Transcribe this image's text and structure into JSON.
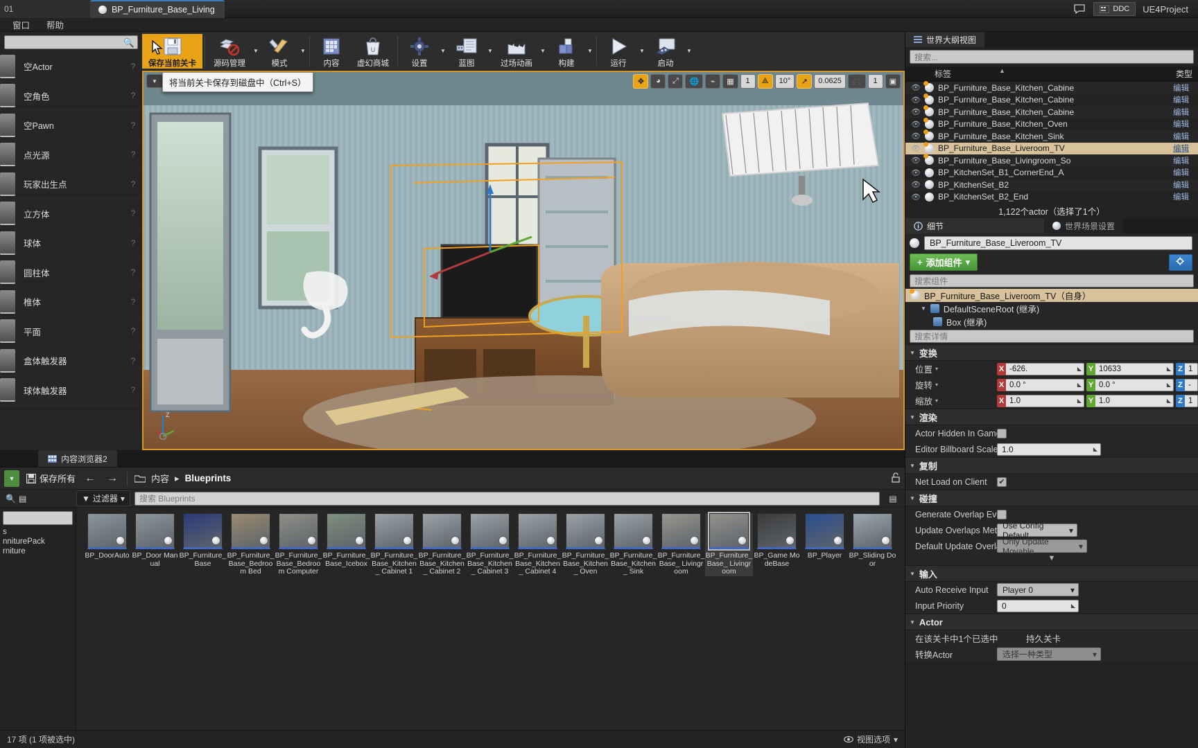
{
  "titlebar": {
    "left_tab": "01",
    "active_tab": "BP_Furniture_Base_Living",
    "ddc_label": "DDC",
    "project": "UE4Project"
  },
  "menubar": {
    "items": [
      "窗口",
      "帮助"
    ]
  },
  "toolbar": {
    "items": [
      {
        "label": "保存当前关卡",
        "icon": "save-icon",
        "highlight": true,
        "caret": false
      },
      {
        "label": "源码管理",
        "icon": "source-control-icon",
        "caret": true
      },
      {
        "label": "模式",
        "icon": "modes-icon",
        "caret": true
      },
      {
        "label": "内容",
        "icon": "content-icon",
        "caret": false
      },
      {
        "label": "虚幻商城",
        "icon": "marketplace-icon",
        "caret": false
      },
      {
        "label": "设置",
        "icon": "settings-icon",
        "caret": true
      },
      {
        "label": "蓝图",
        "icon": "blueprint-icon",
        "caret": true
      },
      {
        "label": "过场动画",
        "icon": "cinematics-icon",
        "caret": true
      },
      {
        "label": "构建",
        "icon": "build-icon",
        "caret": true
      },
      {
        "label": "运行",
        "icon": "play-icon",
        "caret": true
      },
      {
        "label": "启动",
        "icon": "launch-icon",
        "caret": true
      }
    ],
    "tooltip": "将当前关卡保存到磁盘中（Ctrl+S）"
  },
  "place_actors": {
    "search_placeholder": "",
    "items": [
      {
        "label": "空Actor",
        "icon": "empty-actor-icon"
      },
      {
        "label": "空角色",
        "icon": "character-icon"
      },
      {
        "label": "空Pawn",
        "icon": "pawn-icon"
      },
      {
        "label": "点光源",
        "icon": "point-light-icon"
      },
      {
        "label": "玩家出生点",
        "icon": "player-start-icon"
      },
      {
        "label": "立方体",
        "icon": "cube-icon"
      },
      {
        "label": "球体",
        "icon": "sphere-icon"
      },
      {
        "label": "圆柱体",
        "icon": "cylinder-icon"
      },
      {
        "label": "椎体",
        "icon": "cone-icon"
      },
      {
        "label": "平面",
        "icon": "plane-icon"
      },
      {
        "label": "盒体触发器",
        "icon": "box-trigger-icon"
      },
      {
        "label": "球体触发器",
        "icon": "sphere-trigger-icon"
      }
    ],
    "help_glyph": "?"
  },
  "viewport": {
    "tools": [
      {
        "name": "move-tool",
        "glyph": "✥",
        "active": true
      },
      {
        "name": "rotate-tool",
        "glyph": "◕",
        "active": false
      },
      {
        "name": "scale-tool",
        "glyph": "⤢",
        "active": false
      },
      {
        "name": "world-space-toggle",
        "glyph": "🌐",
        "active": false
      },
      {
        "name": "surface-snap",
        "glyph": "⌁",
        "active": false
      },
      {
        "name": "grid-snap",
        "glyph": "▦",
        "active": false
      },
      {
        "name": "grid-size-value",
        "glyph": "1",
        "active": false
      },
      {
        "name": "angle-snap",
        "glyph": "⟁",
        "active": true
      },
      {
        "name": "angle-value",
        "glyph": "10°",
        "active": false
      },
      {
        "name": "scale-snap",
        "glyph": "↗",
        "active": true
      },
      {
        "name": "scale-value",
        "glyph": "0.0625",
        "active": false
      },
      {
        "name": "camera-speed",
        "glyph": "🎥",
        "active": false
      },
      {
        "name": "camera-speed-value",
        "glyph": "1",
        "active": false
      },
      {
        "name": "maximize-viewport",
        "glyph": "▣",
        "active": false
      }
    ],
    "axis_label": "Z"
  },
  "content_browser": {
    "tab_label": "内容浏览器2",
    "save_all": "保存所有",
    "breadcrumb": [
      "内容",
      "Blueprints"
    ],
    "filter_label": "过滤器",
    "search_placeholder": "搜索 Blueprints",
    "tree_items": [
      "s",
      "nniturePack",
      "rniture"
    ],
    "assets": [
      {
        "label": "BP_DoorAuto",
        "selected": false
      },
      {
        "label": "BP_Door Manual",
        "selected": false
      },
      {
        "label": "BP_Furniture_ Base",
        "selected": false
      },
      {
        "label": "BP_Furniture_ Base_Bedroom Bed",
        "selected": false
      },
      {
        "label": "BP_Furniture_ Base_Bedroom Computer",
        "selected": false
      },
      {
        "label": "BP_Furniture_ Base_Icebox",
        "selected": false
      },
      {
        "label": "BP_Furniture_ Base_Kitchen_ Cabinet 1",
        "selected": false
      },
      {
        "label": "BP_Furniture_ Base_Kitchen_ Cabinet 2",
        "selected": false
      },
      {
        "label": "BP_Furniture_ Base_Kitchen_ Cabinet 3",
        "selected": false
      },
      {
        "label": "BP_Furniture_ Base_Kitchen_ Cabinet 4",
        "selected": false
      },
      {
        "label": "BP_Furniture_ Base_Kitchen_ Oven",
        "selected": false
      },
      {
        "label": "BP_Furniture_ Base_Kitchen_ Sink",
        "selected": false
      },
      {
        "label": "BP_Furniture_ Base_ Livingroom",
        "selected": false
      },
      {
        "label": "BP_Furniture_ Base_ Livingroom",
        "selected": true
      },
      {
        "label": "BP_Game ModeBase",
        "selected": false
      },
      {
        "label": "BP_Player",
        "selected": false
      },
      {
        "label": "BP_Sliding Door",
        "selected": false
      }
    ],
    "status": "17 项 (1 项被选中)",
    "view_options": "视图选项"
  },
  "world_outliner": {
    "tab_label": "世界大纲视图",
    "search_placeholder": "搜索...",
    "col_label": "标签",
    "col_type": "类型",
    "rows": [
      {
        "label": "BP_Furniture_Base_Kitchen_Cabine",
        "type": "编辑",
        "blueprint": true,
        "selected": false
      },
      {
        "label": "BP_Furniture_Base_Kitchen_Cabine",
        "type": "编辑",
        "blueprint": true,
        "selected": false
      },
      {
        "label": "BP_Furniture_Base_Kitchen_Cabine",
        "type": "编辑",
        "blueprint": true,
        "selected": false
      },
      {
        "label": "BP_Furniture_Base_Kitchen_Oven",
        "type": "编辑",
        "blueprint": true,
        "selected": false
      },
      {
        "label": "BP_Furniture_Base_Kitchen_Sink",
        "type": "编辑",
        "blueprint": true,
        "selected": false
      },
      {
        "label": "BP_Furniture_Base_Liveroom_TV",
        "type": "编辑",
        "blueprint": true,
        "selected": true
      },
      {
        "label": "BP_Furniture_Base_Livingroom_So",
        "type": "编辑",
        "blueprint": true,
        "selected": false
      },
      {
        "label": "BP_KitchenSet_B1_CornerEnd_A",
        "type": "编辑",
        "blueprint": false,
        "selected": false
      },
      {
        "label": "BP_KitchenSet_B2",
        "type": "编辑",
        "blueprint": false,
        "selected": false
      },
      {
        "label": "BP_KitchenSet_B2_End",
        "type": "编辑",
        "blueprint": false,
        "selected": false
      }
    ],
    "count_text": "1,122个actor（选择了1个）"
  },
  "details": {
    "tab_details": "细节",
    "tab_world_settings": "世界场景设置",
    "actor_name": "BP_Furniture_Base_Liveroom_TV",
    "add_component": "添加组件",
    "component_search_placeholder": "搜索组件",
    "components": [
      {
        "label": "BP_Furniture_Base_Liveroom_TV（自身）",
        "indent": 0,
        "selected": true,
        "icon": "blueprint-sphere-icon"
      },
      {
        "label": "DefaultSceneRoot (继承)",
        "indent": 1,
        "selected": false,
        "icon": "scene-root-icon"
      },
      {
        "label": "Box (继承)",
        "indent": 2,
        "selected": false,
        "icon": "box-component-icon"
      }
    ],
    "details_search_placeholder": "搜索详情",
    "transform": {
      "title": "变换",
      "rows": [
        {
          "label": "位置",
          "x": "-626.",
          "y": "10633",
          "z": "1"
        },
        {
          "label": "旋转",
          "x": "0.0 °",
          "y": "0.0 °",
          "z": "-"
        },
        {
          "label": "缩放",
          "x": "1.0",
          "y": "1.0",
          "z": "1"
        }
      ]
    },
    "rendering": {
      "title": "渲染",
      "actor_hidden_label": "Actor Hidden In Game",
      "actor_hidden_checked": false,
      "billboard_label": "Editor Billboard Scale",
      "billboard_value": "1.0"
    },
    "replication": {
      "title": "复制",
      "net_load_label": "Net Load on Client",
      "net_load_checked": true
    },
    "collision": {
      "title": "碰撞",
      "generate_overlap_label": "Generate Overlap Even",
      "generate_overlap_checked": false,
      "update_overlaps_label": "Update Overlaps Meth",
      "update_overlaps_value": "Use Config Default",
      "default_update_label": "Default Update Overla",
      "default_update_value": "Only Update Movable"
    },
    "input": {
      "title": "输入",
      "auto_receive_label": "Auto Receive Input",
      "auto_receive_value": "Player 0",
      "input_priority_label": "Input Priority",
      "input_priority_value": "0"
    },
    "actor": {
      "title": "Actor",
      "selected_label": "在该关卡中1个已选中",
      "selected_value": "持久关卡",
      "convert_label": "转换Actor",
      "convert_value": "选择一种类型"
    }
  },
  "colors": {
    "accent_orange": "#e8a317",
    "selection_tan": "#d7c29c",
    "green_button": "#4d9440",
    "blue_button": "#3c85d0",
    "axis_x": "#b33a3a",
    "axis_y": "#61a832",
    "axis_z": "#2f78c4"
  }
}
